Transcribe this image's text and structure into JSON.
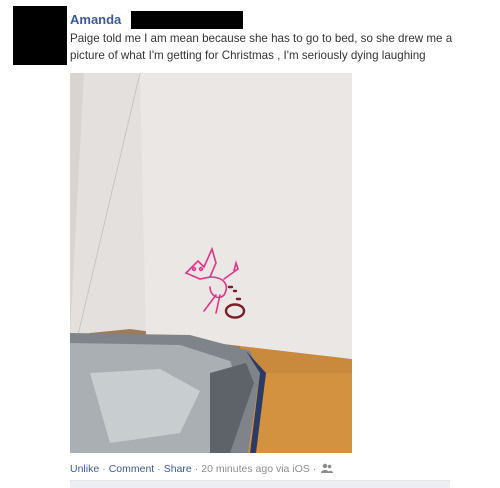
{
  "post": {
    "author": "Amanda",
    "text": "Paige told me I am mean because she has to go to bed, so she drew me a picture of what I'm getting for Christmas , I'm seriously dying laughing"
  },
  "footer": {
    "unlike": "Unlike",
    "comment": "Comment",
    "share": "Share",
    "timestamp": "20 minutes ago via iOS",
    "separator": "·",
    "audience_icon": "friends-icon"
  },
  "colors": {
    "link": "#3b5998",
    "muted": "#8d8d8d",
    "drawing": "#e0338a"
  }
}
